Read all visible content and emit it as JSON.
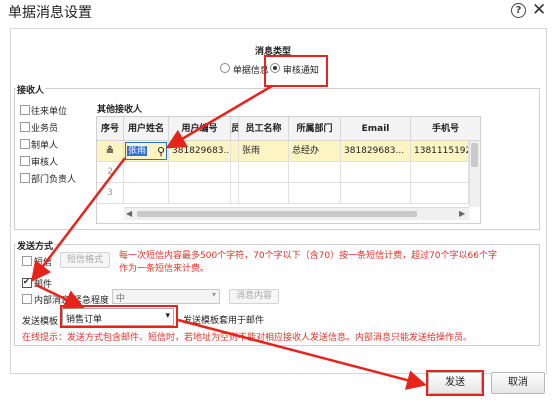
{
  "window": {
    "title": "单据消息设置"
  },
  "message_type": {
    "legend": "消息类型",
    "options": [
      {
        "label": "单据信息",
        "selected": false
      },
      {
        "label": "审核通知",
        "selected": true
      }
    ]
  },
  "recipients": {
    "legend": "接收人",
    "roles": [
      "往来单位",
      "业务员",
      "制单人",
      "审核人",
      "部门负责人"
    ],
    "other_legend": "其他接收人",
    "columns": [
      "序号",
      "用户姓名",
      "用户编号",
      "员",
      "员工名称",
      "所属部门",
      "Email",
      "手机号"
    ],
    "rows": [
      {
        "index": "",
        "user_name": "张雨",
        "user_code": "381829683...",
        "emp_name": "张雨",
        "dept": "总经办",
        "email": "381829683...",
        "phone": "1381115192"
      },
      {
        "index": "2"
      },
      {
        "index": "3"
      }
    ]
  },
  "send": {
    "legend": "发送方式",
    "sms_label": "短信",
    "sms_format_button": "短信格式",
    "sms_note": "每一次短信内容最多500个字符，70个字以下（含70）按一条短信计费，超过70个字以66个字作为一条短信来计费。",
    "mail_label": "邮件",
    "mail_checked": true,
    "internal_label": "内部消息",
    "urgency_label": "紧急程度",
    "urgency_value": "中",
    "message_content_button": "消息内容",
    "template_label": "发送模板",
    "template_value": "销售订单",
    "template_note": "发送模板套用于邮件",
    "tip": "在线提示：发送方式包含邮件、短信时，若地址为空则不能对相应接收人发送信息。内部消息只能发送给操作员。"
  },
  "footer": {
    "send_button": "发送",
    "cancel_button": "取消"
  },
  "colors": {
    "highlight_row": "#fdf4c4",
    "annotation": "#e8231b",
    "tip_red": "#e2332a"
  }
}
